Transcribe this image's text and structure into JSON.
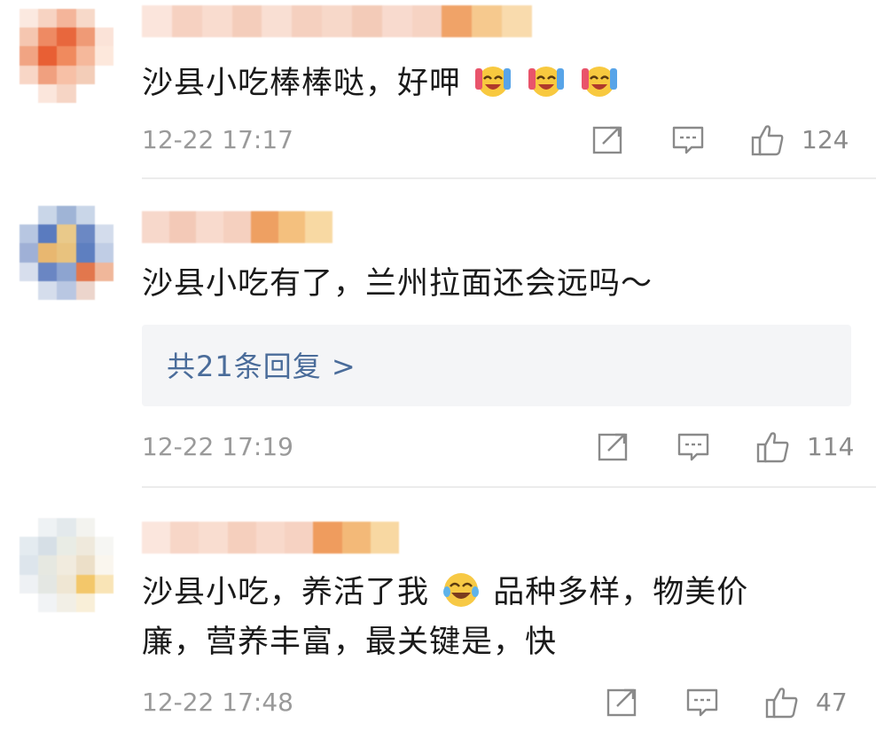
{
  "comments": [
    {
      "text_before_emoji": "沙县小吃棒棒哒，好呷",
      "emoji_count": 3,
      "emoji_name": "cheering-laugh-emoji",
      "time": "12-22 17:17",
      "likes": "124"
    },
    {
      "text": "沙县小吃有了，兰州拉面还会远吗～",
      "replies_label": "共21条回复 >",
      "time": "12-22 17:19",
      "likes": "114"
    },
    {
      "text_part1": "沙县小吃，养活了我",
      "emoji_name": "crying-laughing-emoji",
      "text_part2": "品种多样，物美价",
      "text_line2": "廉，营养丰富，最关键是，快",
      "time": "12-22 17:48",
      "likes": "47"
    }
  ],
  "icons": {
    "share": "share-icon",
    "comment": "comment-icon",
    "like": "thumbs-up-icon"
  },
  "colors": {
    "timestamp": "#9a9a9a",
    "reply_link": "#4a6c9a",
    "reply_bg": "#f4f5f7",
    "divider": "#ececec",
    "icon": "#8a8a8a"
  }
}
